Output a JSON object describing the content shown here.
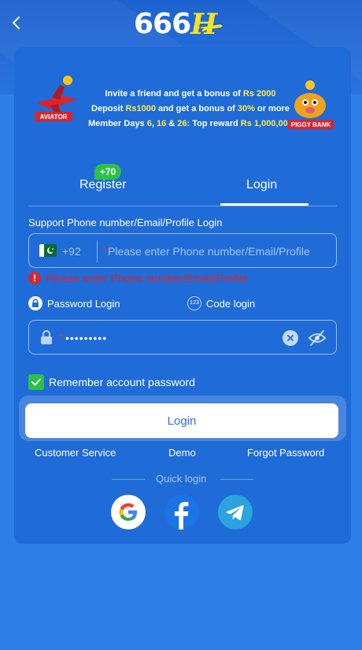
{
  "header": {
    "logo_text": "666",
    "logo_mark": "H"
  },
  "banner": {
    "line1_pre": "Invite a friend and get a bonus of ",
    "line1_amount": "Rs 2000",
    "line2_pre": "Deposit ",
    "line2_deposit": "Rs1000",
    "line2_mid": " and get a bonus of ",
    "line2_pct": "30%",
    "line2_post": " or more",
    "line3_pre": "Member Days ",
    "line3_d1": "6",
    "line3_sep1": ", ",
    "line3_d2": "16",
    "line3_sep2": " & ",
    "line3_d3": "26",
    "line3_mid": ": Top reward ",
    "line3_reward": "Rs 1,000,000",
    "left_game": "AVIATOR",
    "right_game": "PIGGY BANK"
  },
  "tabs": {
    "register": "Register",
    "register_badge": "+70",
    "login": "Login"
  },
  "form": {
    "support_label": "Support Phone number/Email/Profile Login",
    "country_code": "+92",
    "phone_placeholder": "Please enter Phone number/Email/Profile",
    "required_mark": "*",
    "error_text": "Please enter Phone number/Email/Profile",
    "mode_password": "Password Login",
    "mode_code": "Code login",
    "code_icon_text": "123",
    "password_value": "•••••••••",
    "remember_label": "Remember account password"
  },
  "actions": {
    "login_button": "Login",
    "customer_service": "Customer Service",
    "demo": "Demo",
    "forgot_password": "Forgot Password",
    "quick_login": "Quick login"
  },
  "colors": {
    "background": "#2f7ee8",
    "card": "#1f6bd8",
    "accent_yellow": "#ffe94d",
    "error_red": "#d8262f",
    "success_green": "#2bc24a"
  },
  "icons": {
    "back": "chevron-left-icon",
    "lock": "lock-icon",
    "clear": "clear-icon",
    "eye": "eye-off-icon",
    "google": "google-icon",
    "facebook": "facebook-icon",
    "telegram": "telegram-icon"
  }
}
